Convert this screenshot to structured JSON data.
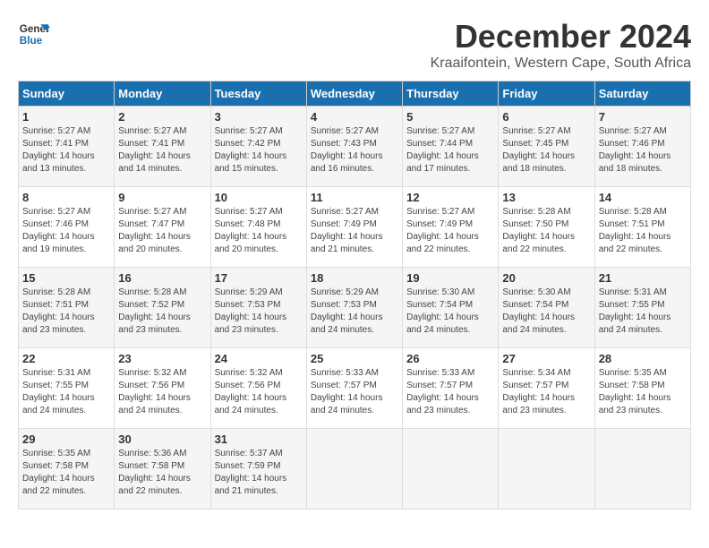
{
  "logo": {
    "line1": "General",
    "line2": "Blue"
  },
  "title": "December 2024",
  "location": "Kraaifontein, Western Cape, South Africa",
  "headers": [
    "Sunday",
    "Monday",
    "Tuesday",
    "Wednesday",
    "Thursday",
    "Friday",
    "Saturday"
  ],
  "weeks": [
    [
      {
        "day": "1",
        "sunrise": "5:27 AM",
        "sunset": "7:41 PM",
        "daylight": "14 hours and 13 minutes."
      },
      {
        "day": "2",
        "sunrise": "5:27 AM",
        "sunset": "7:41 PM",
        "daylight": "14 hours and 14 minutes."
      },
      {
        "day": "3",
        "sunrise": "5:27 AM",
        "sunset": "7:42 PM",
        "daylight": "14 hours and 15 minutes."
      },
      {
        "day": "4",
        "sunrise": "5:27 AM",
        "sunset": "7:43 PM",
        "daylight": "14 hours and 16 minutes."
      },
      {
        "day": "5",
        "sunrise": "5:27 AM",
        "sunset": "7:44 PM",
        "daylight": "14 hours and 17 minutes."
      },
      {
        "day": "6",
        "sunrise": "5:27 AM",
        "sunset": "7:45 PM",
        "daylight": "14 hours and 18 minutes."
      },
      {
        "day": "7",
        "sunrise": "5:27 AM",
        "sunset": "7:46 PM",
        "daylight": "14 hours and 18 minutes."
      }
    ],
    [
      {
        "day": "8",
        "sunrise": "5:27 AM",
        "sunset": "7:46 PM",
        "daylight": "14 hours and 19 minutes."
      },
      {
        "day": "9",
        "sunrise": "5:27 AM",
        "sunset": "7:47 PM",
        "daylight": "14 hours and 20 minutes."
      },
      {
        "day": "10",
        "sunrise": "5:27 AM",
        "sunset": "7:48 PM",
        "daylight": "14 hours and 20 minutes."
      },
      {
        "day": "11",
        "sunrise": "5:27 AM",
        "sunset": "7:49 PM",
        "daylight": "14 hours and 21 minutes."
      },
      {
        "day": "12",
        "sunrise": "5:27 AM",
        "sunset": "7:49 PM",
        "daylight": "14 hours and 22 minutes."
      },
      {
        "day": "13",
        "sunrise": "5:28 AM",
        "sunset": "7:50 PM",
        "daylight": "14 hours and 22 minutes."
      },
      {
        "day": "14",
        "sunrise": "5:28 AM",
        "sunset": "7:51 PM",
        "daylight": "14 hours and 22 minutes."
      }
    ],
    [
      {
        "day": "15",
        "sunrise": "5:28 AM",
        "sunset": "7:51 PM",
        "daylight": "14 hours and 23 minutes."
      },
      {
        "day": "16",
        "sunrise": "5:28 AM",
        "sunset": "7:52 PM",
        "daylight": "14 hours and 23 minutes."
      },
      {
        "day": "17",
        "sunrise": "5:29 AM",
        "sunset": "7:53 PM",
        "daylight": "14 hours and 23 minutes."
      },
      {
        "day": "18",
        "sunrise": "5:29 AM",
        "sunset": "7:53 PM",
        "daylight": "14 hours and 24 minutes."
      },
      {
        "day": "19",
        "sunrise": "5:30 AM",
        "sunset": "7:54 PM",
        "daylight": "14 hours and 24 minutes."
      },
      {
        "day": "20",
        "sunrise": "5:30 AM",
        "sunset": "7:54 PM",
        "daylight": "14 hours and 24 minutes."
      },
      {
        "day": "21",
        "sunrise": "5:31 AM",
        "sunset": "7:55 PM",
        "daylight": "14 hours and 24 minutes."
      }
    ],
    [
      {
        "day": "22",
        "sunrise": "5:31 AM",
        "sunset": "7:55 PM",
        "daylight": "14 hours and 24 minutes."
      },
      {
        "day": "23",
        "sunrise": "5:32 AM",
        "sunset": "7:56 PM",
        "daylight": "14 hours and 24 minutes."
      },
      {
        "day": "24",
        "sunrise": "5:32 AM",
        "sunset": "7:56 PM",
        "daylight": "14 hours and 24 minutes."
      },
      {
        "day": "25",
        "sunrise": "5:33 AM",
        "sunset": "7:57 PM",
        "daylight": "14 hours and 24 minutes."
      },
      {
        "day": "26",
        "sunrise": "5:33 AM",
        "sunset": "7:57 PM",
        "daylight": "14 hours and 23 minutes."
      },
      {
        "day": "27",
        "sunrise": "5:34 AM",
        "sunset": "7:57 PM",
        "daylight": "14 hours and 23 minutes."
      },
      {
        "day": "28",
        "sunrise": "5:35 AM",
        "sunset": "7:58 PM",
        "daylight": "14 hours and 23 minutes."
      }
    ],
    [
      {
        "day": "29",
        "sunrise": "5:35 AM",
        "sunset": "7:58 PM",
        "daylight": "14 hours and 22 minutes."
      },
      {
        "day": "30",
        "sunrise": "5:36 AM",
        "sunset": "7:58 PM",
        "daylight": "14 hours and 22 minutes."
      },
      {
        "day": "31",
        "sunrise": "5:37 AM",
        "sunset": "7:59 PM",
        "daylight": "14 hours and 21 minutes."
      },
      null,
      null,
      null,
      null
    ]
  ]
}
